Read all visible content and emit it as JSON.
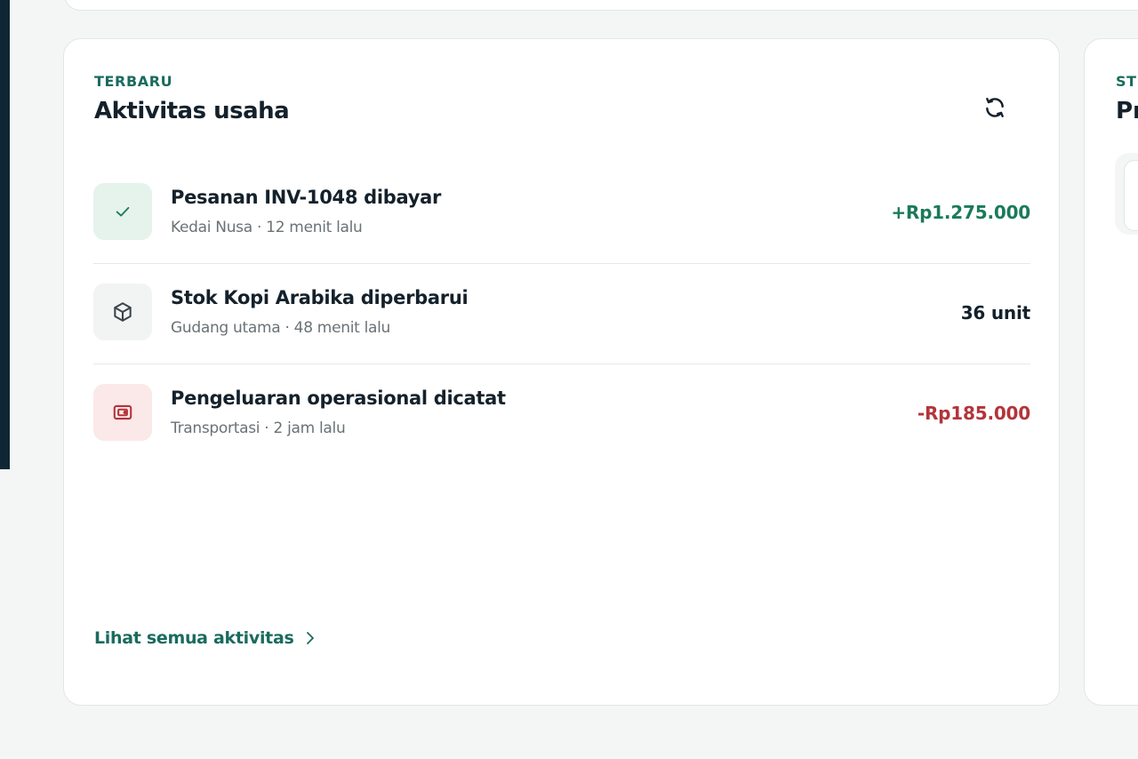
{
  "activity_card": {
    "eyebrow": "TERBARU",
    "title": "Aktivitas usaha",
    "refresh_icon": "refresh-icon",
    "items": [
      {
        "icon": "check-icon",
        "title": "Pesanan INV-1048 dibayar",
        "meta": "Kedai Nusa · 12 menit lalu",
        "value": "+Rp1.275.000",
        "value_color": "#1a7a5a"
      },
      {
        "icon": "box-icon",
        "title": "Stok Kopi Arabika diperbarui",
        "meta": "Gudang utama · 48 menit lalu",
        "value": "36 unit",
        "value_color": "#14212b"
      },
      {
        "icon": "wallet-icon",
        "title": "Pengeluaran operasional dicatat",
        "meta": "Transportasi · 2 jam lalu",
        "value": "-Rp185.000",
        "value_color": "#b3343a"
      }
    ],
    "view_all_label": "Lihat semua aktivitas"
  },
  "right_card": {
    "eyebrow": "ST",
    "title": "Pr"
  },
  "colors": {
    "accent": "#1a6b5e",
    "positive": "#1a7a5a",
    "negative": "#b3343a",
    "sidebar": "#0f2734",
    "background": "#f4f6f5"
  }
}
